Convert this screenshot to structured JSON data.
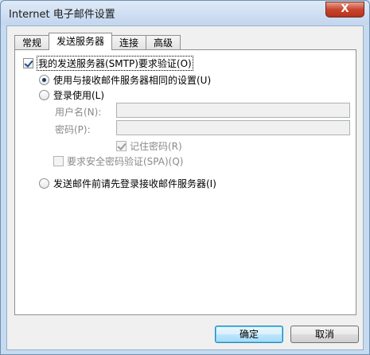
{
  "window": {
    "title": "Internet 电子邮件设置",
    "close_label": "X"
  },
  "tabs": [
    {
      "label": "常规",
      "active": false
    },
    {
      "label": "发送服务器",
      "active": true
    },
    {
      "label": "连接",
      "active": false
    },
    {
      "label": "高级",
      "active": false
    }
  ],
  "outgoing": {
    "smtp_auth": {
      "label": "我的发送服务器(SMTP)要求验证(O)",
      "checked": true
    },
    "use_same": {
      "label": "使用与接收邮件服务器相同的设置(U)",
      "selected": true
    },
    "login_with": {
      "label": "登录使用(L)",
      "selected": false
    },
    "username": {
      "label": "用户名(N):",
      "value": ""
    },
    "password": {
      "label": "密码(P):",
      "value": ""
    },
    "remember": {
      "label": "记住密码(R)",
      "checked": true,
      "enabled": false
    },
    "spa": {
      "label": "要求安全密码验证(SPA)(Q)",
      "checked": false,
      "enabled": false
    },
    "login_before_send": {
      "label": "发送邮件前请先登录接收邮件服务器(I)",
      "selected": false
    }
  },
  "buttons": {
    "ok": "确定",
    "cancel": "取消"
  }
}
